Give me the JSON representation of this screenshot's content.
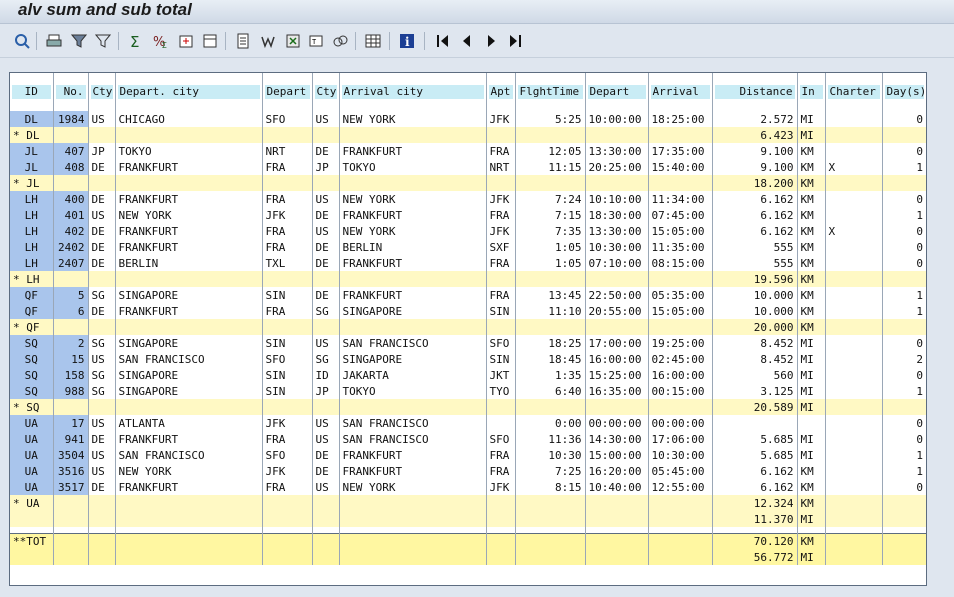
{
  "window": {
    "title": "alv sum and sub total"
  },
  "toolbar": {
    "icons": [
      "details-icon",
      "print-icon",
      "filter-icon",
      "set-filter-icon",
      "sum-icon",
      "subtotal-icon",
      "export-icon",
      "layout-icon",
      "local-file-icon",
      "word-icon",
      "excel-icon",
      "abc-analysis-icon",
      "graphic-icon",
      "grid-icon",
      "info-icon",
      "first-page-icon",
      "previous-page-icon",
      "next-page-icon",
      "last-page-icon"
    ]
  },
  "grid": {
    "headers": [
      "ID",
      "No.",
      "Cty",
      "Depart. city",
      "Depart",
      "Cty",
      "Arrival city",
      "Apt",
      "FlghtTime",
      "Depart",
      "Arrival",
      "Distance",
      "In",
      "Charter",
      "Day(s)"
    ],
    "rows": [
      {
        "type": "data",
        "id": "DL",
        "no": "1984",
        "cty1": "US",
        "dep_city": "CHICAGO",
        "dep_apt": "SFO",
        "cty2": "US",
        "arr_city": "NEW YORK",
        "apt": "JFK",
        "time": "5:25",
        "dep": "10:00:00",
        "arr": "18:25:00",
        "dist": "2.572",
        "unit": "MI",
        "charter": "",
        "days": "0"
      },
      {
        "type": "sub",
        "id": "* DL",
        "dist": "6.423",
        "unit": "MI"
      },
      {
        "type": "data",
        "id": "JL",
        "no": "407",
        "cty1": "JP",
        "dep_city": "TOKYO",
        "dep_apt": "NRT",
        "cty2": "DE",
        "arr_city": "FRANKFURT",
        "apt": "FRA",
        "time": "12:05",
        "dep": "13:30:00",
        "arr": "17:35:00",
        "dist": "9.100",
        "unit": "KM",
        "charter": "",
        "days": "0"
      },
      {
        "type": "data",
        "id": "JL",
        "no": "408",
        "cty1": "DE",
        "dep_city": "FRANKFURT",
        "dep_apt": "FRA",
        "cty2": "JP",
        "arr_city": "TOKYO",
        "apt": "NRT",
        "time": "11:15",
        "dep": "20:25:00",
        "arr": "15:40:00",
        "dist": "9.100",
        "unit": "KM",
        "charter": "X",
        "days": "1"
      },
      {
        "type": "sub",
        "id": "* JL",
        "dist": "18.200",
        "unit": "KM"
      },
      {
        "type": "data",
        "id": "LH",
        "no": "400",
        "cty1": "DE",
        "dep_city": "FRANKFURT",
        "dep_apt": "FRA",
        "cty2": "US",
        "arr_city": "NEW YORK",
        "apt": "JFK",
        "time": "7:24",
        "dep": "10:10:00",
        "arr": "11:34:00",
        "dist": "6.162",
        "unit": "KM",
        "charter": "",
        "days": "0"
      },
      {
        "type": "data",
        "id": "LH",
        "no": "401",
        "cty1": "US",
        "dep_city": "NEW YORK",
        "dep_apt": "JFK",
        "cty2": "DE",
        "arr_city": "FRANKFURT",
        "apt": "FRA",
        "time": "7:15",
        "dep": "18:30:00",
        "arr": "07:45:00",
        "dist": "6.162",
        "unit": "KM",
        "charter": "",
        "days": "1"
      },
      {
        "type": "data",
        "id": "LH",
        "no": "402",
        "cty1": "DE",
        "dep_city": "FRANKFURT",
        "dep_apt": "FRA",
        "cty2": "US",
        "arr_city": "NEW YORK",
        "apt": "JFK",
        "time": "7:35",
        "dep": "13:30:00",
        "arr": "15:05:00",
        "dist": "6.162",
        "unit": "KM",
        "charter": "X",
        "days": "0"
      },
      {
        "type": "data",
        "id": "LH",
        "no": "2402",
        "cty1": "DE",
        "dep_city": "FRANKFURT",
        "dep_apt": "FRA",
        "cty2": "DE",
        "arr_city": "BERLIN",
        "apt": "SXF",
        "time": "1:05",
        "dep": "10:30:00",
        "arr": "11:35:00",
        "dist": "555",
        "unit": "KM",
        "charter": "",
        "days": "0"
      },
      {
        "type": "data",
        "id": "LH",
        "no": "2407",
        "cty1": "DE",
        "dep_city": "BERLIN",
        "dep_apt": "TXL",
        "cty2": "DE",
        "arr_city": "FRANKFURT",
        "apt": "FRA",
        "time": "1:05",
        "dep": "07:10:00",
        "arr": "08:15:00",
        "dist": "555",
        "unit": "KM",
        "charter": "",
        "days": "0"
      },
      {
        "type": "sub",
        "id": "* LH",
        "dist": "19.596",
        "unit": "KM"
      },
      {
        "type": "data",
        "id": "QF",
        "no": "5",
        "cty1": "SG",
        "dep_city": "SINGAPORE",
        "dep_apt": "SIN",
        "cty2": "DE",
        "arr_city": "FRANKFURT",
        "apt": "FRA",
        "time": "13:45",
        "dep": "22:50:00",
        "arr": "05:35:00",
        "dist": "10.000",
        "unit": "KM",
        "charter": "",
        "days": "1"
      },
      {
        "type": "data",
        "id": "QF",
        "no": "6",
        "cty1": "DE",
        "dep_city": "FRANKFURT",
        "dep_apt": "FRA",
        "cty2": "SG",
        "arr_city": "SINGAPORE",
        "apt": "SIN",
        "time": "11:10",
        "dep": "20:55:00",
        "arr": "15:05:00",
        "dist": "10.000",
        "unit": "KM",
        "charter": "",
        "days": "1"
      },
      {
        "type": "sub",
        "id": "* QF",
        "dist": "20.000",
        "unit": "KM"
      },
      {
        "type": "data",
        "id": "SQ",
        "no": "2",
        "cty1": "SG",
        "dep_city": "SINGAPORE",
        "dep_apt": "SIN",
        "cty2": "US",
        "arr_city": "SAN FRANCISCO",
        "apt": "SFO",
        "time": "18:25",
        "dep": "17:00:00",
        "arr": "19:25:00",
        "dist": "8.452",
        "unit": "MI",
        "charter": "",
        "days": "0"
      },
      {
        "type": "data",
        "id": "SQ",
        "no": "15",
        "cty1": "US",
        "dep_city": "SAN FRANCISCO",
        "dep_apt": "SFO",
        "cty2": "SG",
        "arr_city": "SINGAPORE",
        "apt": "SIN",
        "time": "18:45",
        "dep": "16:00:00",
        "arr": "02:45:00",
        "dist": "8.452",
        "unit": "MI",
        "charter": "",
        "days": "2"
      },
      {
        "type": "data",
        "id": "SQ",
        "no": "158",
        "cty1": "SG",
        "dep_city": "SINGAPORE",
        "dep_apt": "SIN",
        "cty2": "ID",
        "arr_city": "JAKARTA",
        "apt": "JKT",
        "time": "1:35",
        "dep": "15:25:00",
        "arr": "16:00:00",
        "dist": "560",
        "unit": "MI",
        "charter": "",
        "days": "0"
      },
      {
        "type": "data",
        "id": "SQ",
        "no": "988",
        "cty1": "SG",
        "dep_city": "SINGAPORE",
        "dep_apt": "SIN",
        "cty2": "JP",
        "arr_city": "TOKYO",
        "apt": "TYO",
        "time": "6:40",
        "dep": "16:35:00",
        "arr": "00:15:00",
        "dist": "3.125",
        "unit": "MI",
        "charter": "",
        "days": "1"
      },
      {
        "type": "sub",
        "id": "* SQ",
        "dist": "20.589",
        "unit": "MI"
      },
      {
        "type": "data",
        "id": "UA",
        "no": "17",
        "cty1": "US",
        "dep_city": "ATLANTA",
        "dep_apt": "JFK",
        "cty2": "US",
        "arr_city": "SAN FRANCISCO",
        "apt": "",
        "time": "0:00",
        "dep": "00:00:00",
        "arr": "00:00:00",
        "dist": "",
        "unit": "",
        "charter": "",
        "days": "0"
      },
      {
        "type": "data",
        "id": "UA",
        "no": "941",
        "cty1": "DE",
        "dep_city": "FRANKFURT",
        "dep_apt": "FRA",
        "cty2": "US",
        "arr_city": "SAN FRANCISCO",
        "apt": "SFO",
        "time": "11:36",
        "dep": "14:30:00",
        "arr": "17:06:00",
        "dist": "5.685",
        "unit": "MI",
        "charter": "",
        "days": "0"
      },
      {
        "type": "data",
        "id": "UA",
        "no": "3504",
        "cty1": "US",
        "dep_city": "SAN FRANCISCO",
        "dep_apt": "SFO",
        "cty2": "DE",
        "arr_city": "FRANKFURT",
        "apt": "FRA",
        "time": "10:30",
        "dep": "15:00:00",
        "arr": "10:30:00",
        "dist": "5.685",
        "unit": "MI",
        "charter": "",
        "days": "1"
      },
      {
        "type": "data",
        "id": "UA",
        "no": "3516",
        "cty1": "US",
        "dep_city": "NEW YORK",
        "dep_apt": "JFK",
        "cty2": "DE",
        "arr_city": "FRANKFURT",
        "apt": "FRA",
        "time": "7:25",
        "dep": "16:20:00",
        "arr": "05:45:00",
        "dist": "6.162",
        "unit": "KM",
        "charter": "",
        "days": "1"
      },
      {
        "type": "data",
        "id": "UA",
        "no": "3517",
        "cty1": "DE",
        "dep_city": "FRANKFURT",
        "dep_apt": "FRA",
        "cty2": "US",
        "arr_city": "NEW YORK",
        "apt": "JFK",
        "time": "8:15",
        "dep": "10:40:00",
        "arr": "12:55:00",
        "dist": "6.162",
        "unit": "KM",
        "charter": "",
        "days": "0"
      },
      {
        "type": "sub",
        "id": "* UA",
        "dist": "12.324",
        "unit": "KM"
      },
      {
        "type": "sub",
        "id": "",
        "dist": "11.370",
        "unit": "MI"
      }
    ],
    "totals": [
      {
        "id": "**TOT",
        "dist": "70.120",
        "unit": "KM"
      },
      {
        "id": "",
        "dist": "56.772",
        "unit": "MI"
      }
    ]
  }
}
